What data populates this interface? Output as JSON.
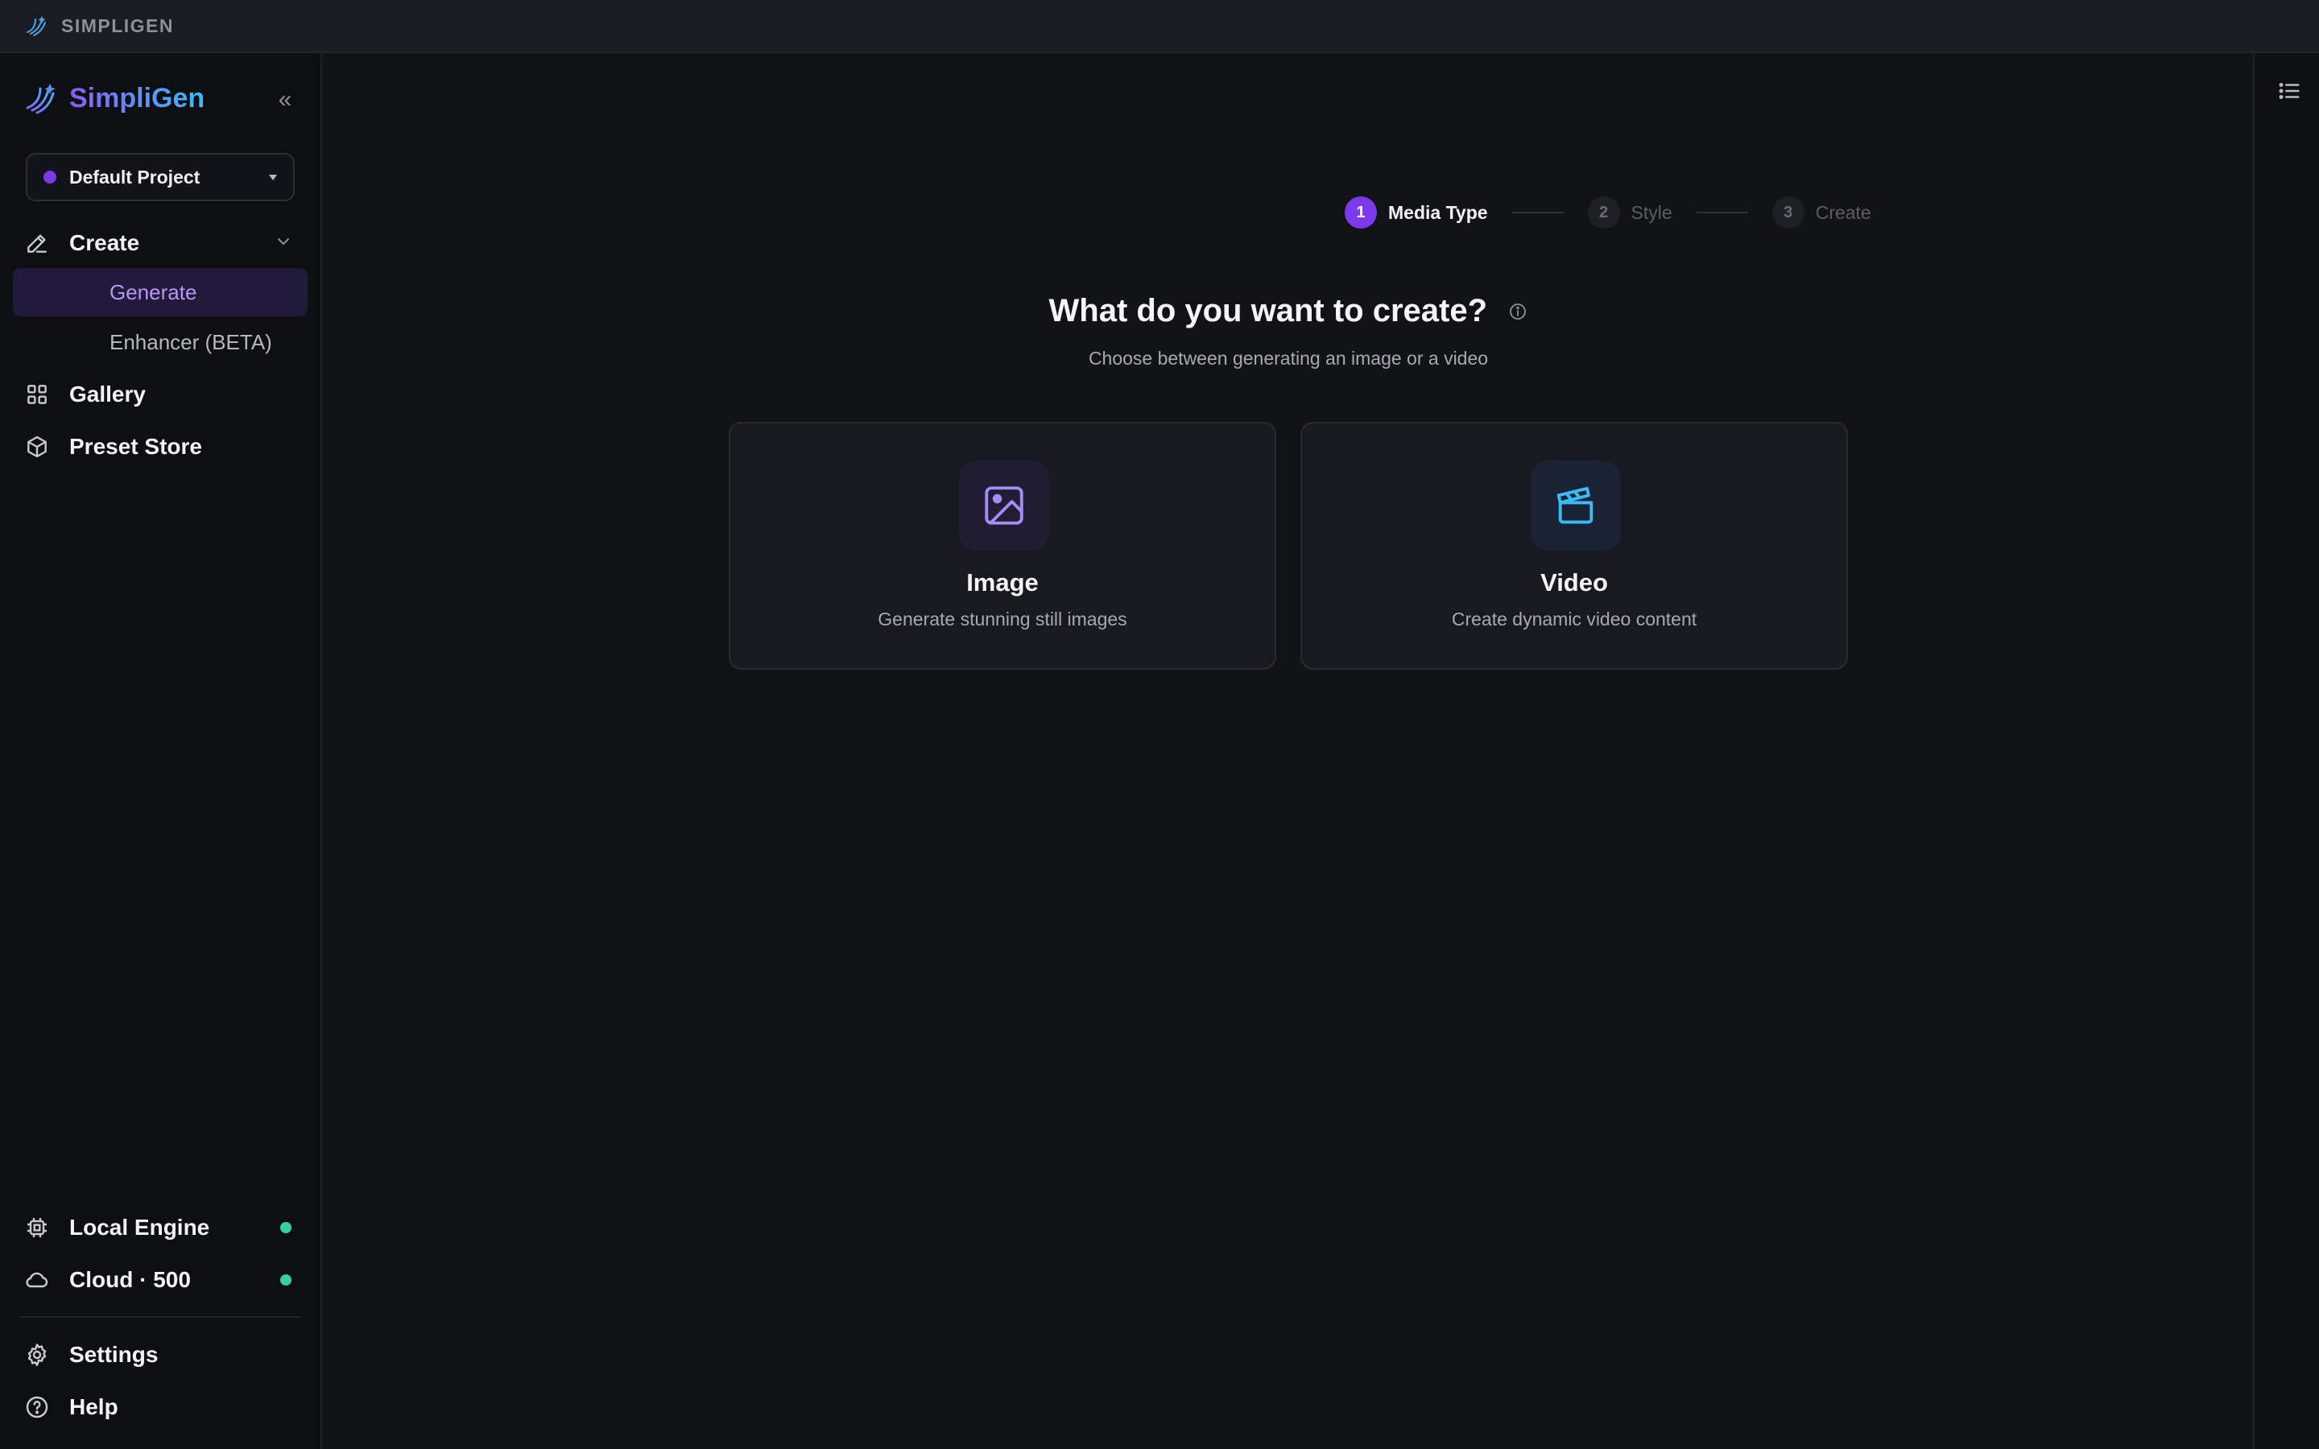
{
  "titlebar": {
    "app_name": "SIMPLIGEN"
  },
  "sidebar": {
    "brand": "SimpliGen",
    "collapse_glyph": "«",
    "project": {
      "label": "Default Project",
      "dot_color": "#7c3aed"
    },
    "create": {
      "label": "Create",
      "icon": "pencil-icon"
    },
    "sub_items": [
      {
        "label": "Generate",
        "active": true
      },
      {
        "label": "Enhancer (BETA)",
        "active": false
      }
    ],
    "gallery": {
      "label": "Gallery",
      "icon": "grid-icon"
    },
    "preset_store": {
      "label": "Preset Store",
      "icon": "box-icon"
    },
    "local_engine": {
      "label": "Local Engine",
      "icon": "chip-icon",
      "status_color": "#34d399"
    },
    "cloud": {
      "label": "Cloud · 500",
      "icon": "cloud-icon",
      "status_color": "#34d399"
    },
    "settings": {
      "label": "Settings",
      "icon": "gear-icon"
    },
    "help": {
      "label": "Help",
      "icon": "help-circle-icon"
    }
  },
  "stepper": {
    "steps": [
      {
        "number": "1",
        "label": "Media Type",
        "active": true
      },
      {
        "number": "2",
        "label": "Style",
        "active": false
      },
      {
        "number": "3",
        "label": "Create",
        "active": false
      }
    ]
  },
  "main": {
    "heading": "What do you want to create?",
    "subheading": "Choose between generating an image or a video",
    "cards": [
      {
        "title": "Image",
        "description": "Generate stunning still images",
        "icon": "image-icon",
        "accent": "#a78bfa"
      },
      {
        "title": "Video",
        "description": "Create dynamic video content",
        "icon": "clapperboard-icon",
        "accent": "#38bdf8"
      }
    ]
  },
  "right_rail": {
    "icon": "list-icon"
  }
}
